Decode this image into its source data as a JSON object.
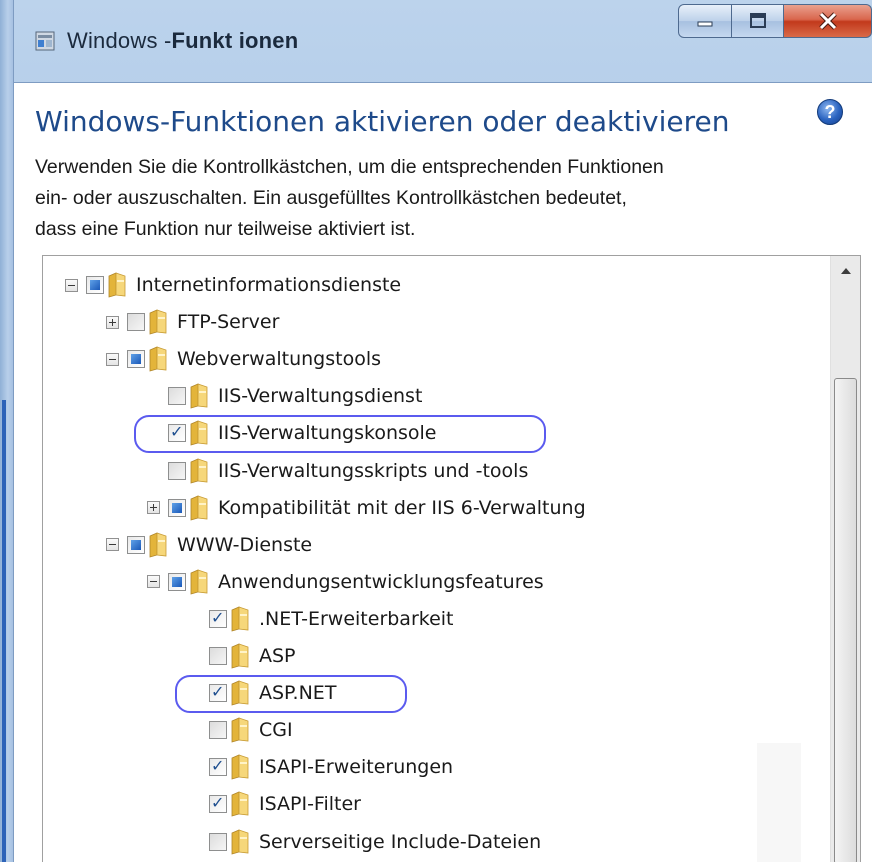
{
  "window": {
    "title_prefix": "Windows -",
    "title_bold": "Funkt ionen",
    "icon": "windows-features-icon"
  },
  "controls": {
    "minimize": "minimize-icon",
    "maximize": "maximize-icon",
    "close": "close-icon"
  },
  "heading": "Windows-Funktionen aktivieren oder deaktivieren",
  "help": "?",
  "description": {
    "line1": "Verwenden Sie die Kontrollkästchen, um die entsprechenden Funktionen",
    "line2": "ein- oder  auszuschalten. Ein ausgefülltes Kontrollkästchen bedeutet,",
    "line3": "dass eine Funktion nur teilweise  aktiviert ist."
  },
  "tree": {
    "items": [
      {
        "label": "Internetinformationsdienste",
        "state": "partial",
        "toggle": "minus"
      },
      {
        "label": "FTP-Server",
        "state": "empty",
        "toggle": "plus"
      },
      {
        "label": "Webverwaltungstools",
        "state": "partial",
        "toggle": "minus"
      },
      {
        "label": "IIS-Verwaltungsdienst",
        "state": "empty",
        "toggle": "none"
      },
      {
        "label": "IIS-Verwaltungskonsole",
        "state": "checked",
        "toggle": "none",
        "highlighted": true
      },
      {
        "label": "IIS-Verwaltungsskripts und -tools",
        "state": "empty",
        "toggle": "none"
      },
      {
        "label": "Kompatibilität mit der IIS 6-Verwaltung",
        "state": "partial",
        "toggle": "plus"
      },
      {
        "label": "WWW-Dienste",
        "state": "partial",
        "toggle": "minus"
      },
      {
        "label": "Anwendungsentwicklungsfeatures",
        "state": "partial",
        "toggle": "minus"
      },
      {
        "label": ".NET-Erweiterbarkeit",
        "state": "checked",
        "toggle": "none"
      },
      {
        "label": "ASP",
        "state": "empty",
        "toggle": "none"
      },
      {
        "label": "ASP.NET",
        "state": "checked",
        "toggle": "none",
        "highlighted": true
      },
      {
        "label": "CGI",
        "state": "empty",
        "toggle": "none"
      },
      {
        "label": "ISAPI-Erweiterungen",
        "state": "checked",
        "toggle": "none"
      },
      {
        "label": "ISAPI-Filter",
        "state": "checked",
        "toggle": "none"
      },
      {
        "label": "Serverseitige Include-Dateien",
        "state": "empty",
        "toggle": "none"
      }
    ]
  }
}
